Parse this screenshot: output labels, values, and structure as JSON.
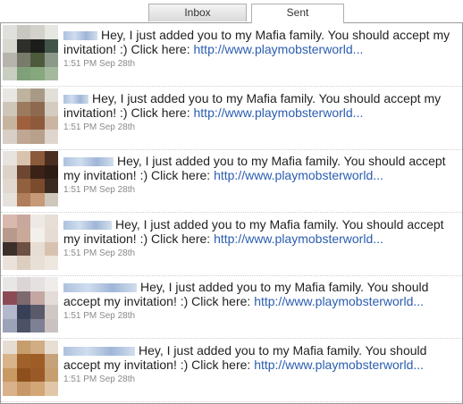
{
  "tabs": [
    {
      "label": "Inbox",
      "active": false
    },
    {
      "label": "Sent",
      "active": true
    }
  ],
  "messages": [
    {
      "text": "Hey, I just added you to my Mafia family. You should accept my invitation! :) Click here: ",
      "link": "http://www.playmobsterworld...",
      "time": "1:51 PM Sep 28th",
      "avatar": [
        "#e0e0dc",
        "#c9c8c0",
        "#d3d1c9",
        "#e6e6e2",
        "#d8d7d0",
        "#2e2e2a",
        "#1c1d1a",
        "#40544a",
        "#b6b4ac",
        "#7a7a6a",
        "#4e5a3c",
        "#8b988a",
        "#c8cfc1",
        "#7fa07a",
        "#87a77c",
        "#a5b99e"
      ],
      "sender_w": 38
    },
    {
      "text": "Hey, I just added you to my Mafia family. You should accept my invitation! :) Click here: ",
      "link": "http://www.playmobsterworld...",
      "time": "1:51 PM Sep 28th",
      "avatar": [
        "#e9e7e3",
        "#bfb3a0",
        "#a89a85",
        "#e2ded8",
        "#cfc6ba",
        "#9c7a5e",
        "#8d6a4f",
        "#d5ccc1",
        "#c7b4a0",
        "#a0603e",
        "#8e5a3c",
        "#cbb5a2",
        "#d8cfc6",
        "#bfa793",
        "#b7a08c",
        "#ded6ce"
      ],
      "sender_w": 28
    },
    {
      "text": "Hey, I just added you to my Mafia family. You should accept my invitation! :) Click here: ",
      "link": "http://www.playmobsterworld...",
      "time": "1:51 PM Sep 28th",
      "avatar": [
        "#e7e3de",
        "#d9c3ae",
        "#8a5a3a",
        "#4a2e20",
        "#dcd2c7",
        "#6e4732",
        "#3a2216",
        "#2c1c14",
        "#e1d9d0",
        "#93603f",
        "#7b4b2d",
        "#3a2a22",
        "#e6e1db",
        "#b07e5a",
        "#c79a77",
        "#cfc6bc"
      ],
      "sender_w": 56
    },
    {
      "text": "Hey, I just added you to my Mafia family. You should accept my invitation! :) Click here: ",
      "link": "http://www.playmobsterworld...",
      "time": "1:51 PM Sep 28th",
      "avatar": [
        "#d9b9ae",
        "#c8a89c",
        "#efe9e5",
        "#e7ded8",
        "#b89a8c",
        "#caa99a",
        "#f3efeb",
        "#e6dcd3",
        "#3d2f2a",
        "#6d5044",
        "#e6ddd4",
        "#d7c2b0",
        "#eae2da",
        "#dccdbf",
        "#e8dfd6",
        "#ede7e0"
      ],
      "sender_w": 54
    },
    {
      "text": "Hey, I just added you to my Mafia family. You should accept my invitation! :) Click here: ",
      "link": "http://www.playmobsterworld...",
      "time": "1:51 PM Sep 28th",
      "avatar": [
        "#e9e6e6",
        "#ddd5d5",
        "#e5e1e0",
        "#efecea",
        "#8a4b55",
        "#7d6a6e",
        "#c4a7a3",
        "#e3dcd9",
        "#b4b8cc",
        "#384058",
        "#5a5a6a",
        "#d0c8c4",
        "#9aa3b8",
        "#4b5266",
        "#7d8193",
        "#c9c2c0"
      ],
      "sender_w": 82
    },
    {
      "text": "Hey, I just added you to my Mafia family. You should accept my invitation! :) Click here: ",
      "link": "http://www.playmobsterworld...",
      "time": "1:51 PM Sep 28th",
      "avatar": [
        "#e6ddd2",
        "#c69d6d",
        "#d0ad82",
        "#e7dfd4",
        "#d7b48a",
        "#a0622b",
        "#9e5d25",
        "#c6a27a",
        "#c89a62",
        "#8e4f1d",
        "#9a5a28",
        "#c79e6e",
        "#d9b18a",
        "#c89768",
        "#d3a677",
        "#e1c7a8"
      ],
      "sender_w": 80
    }
  ]
}
